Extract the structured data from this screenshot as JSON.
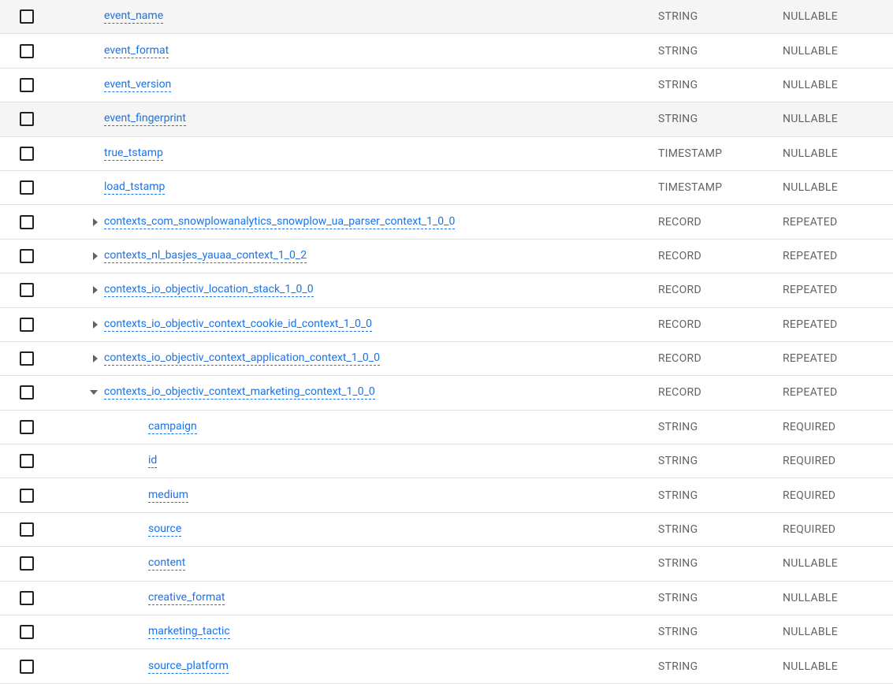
{
  "schema": {
    "rows": [
      {
        "name": "event_name",
        "type": "STRING",
        "mode": "NULLABLE",
        "expandable": false,
        "expanded": false,
        "indent": 0,
        "highlighted": false
      },
      {
        "name": "event_format",
        "type": "STRING",
        "mode": "NULLABLE",
        "expandable": false,
        "expanded": false,
        "indent": 0,
        "highlighted": false
      },
      {
        "name": "event_version",
        "type": "STRING",
        "mode": "NULLABLE",
        "expandable": false,
        "expanded": false,
        "indent": 0,
        "highlighted": false
      },
      {
        "name": "event_fingerprint",
        "type": "STRING",
        "mode": "NULLABLE",
        "expandable": false,
        "expanded": false,
        "indent": 0,
        "highlighted": true
      },
      {
        "name": "true_tstamp",
        "type": "TIMESTAMP",
        "mode": "NULLABLE",
        "expandable": false,
        "expanded": false,
        "indent": 0,
        "highlighted": false
      },
      {
        "name": "load_tstamp",
        "type": "TIMESTAMP",
        "mode": "NULLABLE",
        "expandable": false,
        "expanded": false,
        "indent": 0,
        "highlighted": false
      },
      {
        "name": "contexts_com_snowplowanalytics_snowplow_ua_parser_context_1_0_0",
        "type": "RECORD",
        "mode": "REPEATED",
        "expandable": true,
        "expanded": false,
        "indent": 0,
        "highlighted": false
      },
      {
        "name": "contexts_nl_basjes_yauaa_context_1_0_2",
        "type": "RECORD",
        "mode": "REPEATED",
        "expandable": true,
        "expanded": false,
        "indent": 0,
        "highlighted": false
      },
      {
        "name": "contexts_io_objectiv_location_stack_1_0_0",
        "type": "RECORD",
        "mode": "REPEATED",
        "expandable": true,
        "expanded": false,
        "indent": 0,
        "highlighted": false
      },
      {
        "name": "contexts_io_objectiv_context_cookie_id_context_1_0_0",
        "type": "RECORD",
        "mode": "REPEATED",
        "expandable": true,
        "expanded": false,
        "indent": 0,
        "highlighted": false
      },
      {
        "name": "contexts_io_objectiv_context_application_context_1_0_0",
        "type": "RECORD",
        "mode": "REPEATED",
        "expandable": true,
        "expanded": false,
        "indent": 0,
        "highlighted": false
      },
      {
        "name": "contexts_io_objectiv_context_marketing_context_1_0_0",
        "type": "RECORD",
        "mode": "REPEATED",
        "expandable": true,
        "expanded": true,
        "indent": 0,
        "highlighted": false
      },
      {
        "name": "campaign",
        "type": "STRING",
        "mode": "REQUIRED",
        "expandable": false,
        "expanded": false,
        "indent": 1,
        "highlighted": false
      },
      {
        "name": "id",
        "type": "STRING",
        "mode": "REQUIRED",
        "expandable": false,
        "expanded": false,
        "indent": 1,
        "highlighted": false
      },
      {
        "name": "medium",
        "type": "STRING",
        "mode": "REQUIRED",
        "expandable": false,
        "expanded": false,
        "indent": 1,
        "highlighted": false
      },
      {
        "name": "source",
        "type": "STRING",
        "mode": "REQUIRED",
        "expandable": false,
        "expanded": false,
        "indent": 1,
        "highlighted": false
      },
      {
        "name": "content",
        "type": "STRING",
        "mode": "NULLABLE",
        "expandable": false,
        "expanded": false,
        "indent": 1,
        "highlighted": false
      },
      {
        "name": "creative_format",
        "type": "STRING",
        "mode": "NULLABLE",
        "expandable": false,
        "expanded": false,
        "indent": 1,
        "highlighted": false
      },
      {
        "name": "marketing_tactic",
        "type": "STRING",
        "mode": "NULLABLE",
        "expandable": false,
        "expanded": false,
        "indent": 1,
        "highlighted": false
      },
      {
        "name": "source_platform",
        "type": "STRING",
        "mode": "NULLABLE",
        "expandable": false,
        "expanded": false,
        "indent": 1,
        "highlighted": false
      }
    ]
  }
}
